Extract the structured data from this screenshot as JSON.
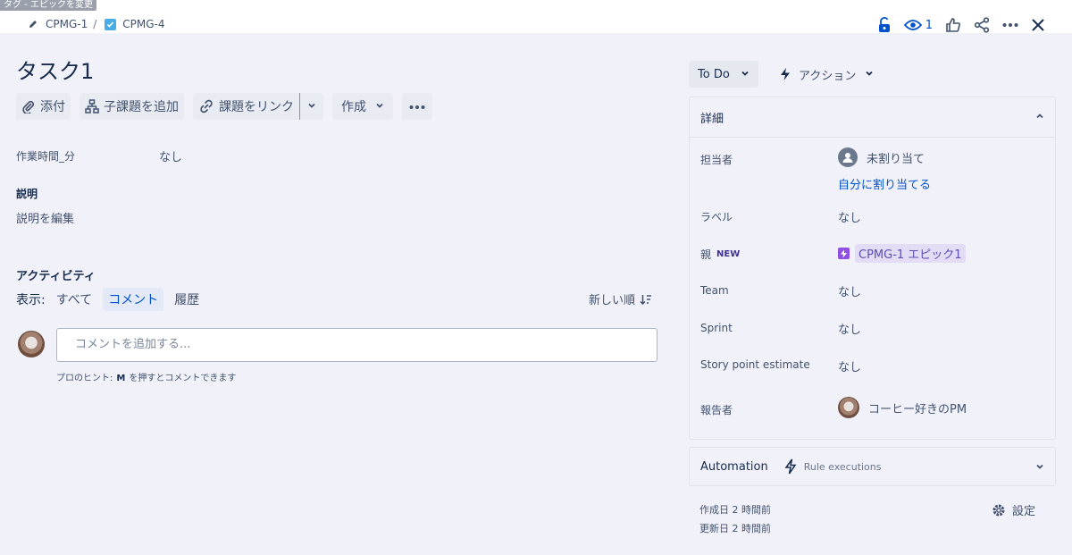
{
  "tooltip": "タグ - エピックを変更",
  "breadcrumb": {
    "parent": "CPMG-1",
    "separator": "/",
    "current": "CPMG-4"
  },
  "top": {
    "watch_count": "1"
  },
  "issue": {
    "title": "タスク1"
  },
  "toolbar": {
    "attach": "添付",
    "add_child": "子課題を追加",
    "link_issue": "課題をリンク",
    "create": "作成"
  },
  "fields": {
    "work_time_label": "作業時間_分",
    "work_time_value": "なし",
    "description_label": "説明",
    "description_placeholder": "説明を編集"
  },
  "activity": {
    "heading": "アクティビティ",
    "show_label": "表示:",
    "filters": [
      "すべて",
      "コメント",
      "履歴"
    ],
    "active_filter": "コメント",
    "sort_label": "新しい順",
    "comment_placeholder": "コメントを追加する...",
    "hint_prefix": "プロのヒント:",
    "hint_key": "M",
    "hint_suffix": "を押すとコメントできます"
  },
  "status": {
    "label": "To Do"
  },
  "actions": {
    "label": "アクション"
  },
  "details": {
    "heading": "詳細",
    "assignee_label": "担当者",
    "assignee_value": "未割り当て",
    "assign_self": "自分に割り当てる",
    "labels_label": "ラベル",
    "labels_value": "なし",
    "parent_label": "親",
    "parent_badge": "NEW",
    "parent_value": "CPMG-1 エピック1",
    "team_label": "Team",
    "team_value": "なし",
    "sprint_label": "Sprint",
    "sprint_value": "なし",
    "story_points_label": "Story point estimate",
    "story_points_value": "なし",
    "reporter_label": "報告者",
    "reporter_value": "コーヒー好きのPM"
  },
  "automation": {
    "title": "Automation",
    "subtitle": "Rule executions"
  },
  "meta": {
    "created": "作成日 2 時間前",
    "updated": "更新日 2 時間前",
    "settings": "設定"
  },
  "colors": {
    "accent": "#0052cc",
    "epic": "#904ee2",
    "task": "#4bade8",
    "background": "#f1f1fa"
  }
}
